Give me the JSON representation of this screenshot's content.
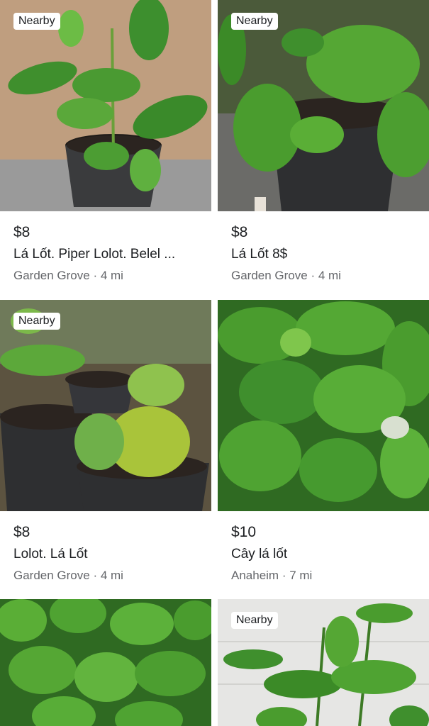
{
  "listings": [
    {
      "badge": "Nearby",
      "price": "$8",
      "title": "Lá Lốt.     Piper Lolot.  Belel ...",
      "location": "Garden Grove · 4 mi"
    },
    {
      "badge": "Nearby",
      "price": "$8",
      "title": "Lá Lốt 8$",
      "location": "Garden Grove · 4 mi"
    },
    {
      "badge": "Nearby",
      "price": "$8",
      "title": "Lolot. Lá Lốt",
      "location": "Garden Grove · 4 mi"
    },
    {
      "badge": "",
      "price": "$10",
      "title": "Cây lá lốt",
      "location": "Anaheim · 7 mi"
    },
    {
      "badge": "",
      "price": "",
      "title": "",
      "location": ""
    },
    {
      "badge": "Nearby",
      "price": "",
      "title": "",
      "location": ""
    }
  ],
  "colors": {
    "leaf": "#3d8f2e",
    "leaf_light": "#7cc043",
    "soil": "#2b2420",
    "pot": "#2e2f31"
  }
}
